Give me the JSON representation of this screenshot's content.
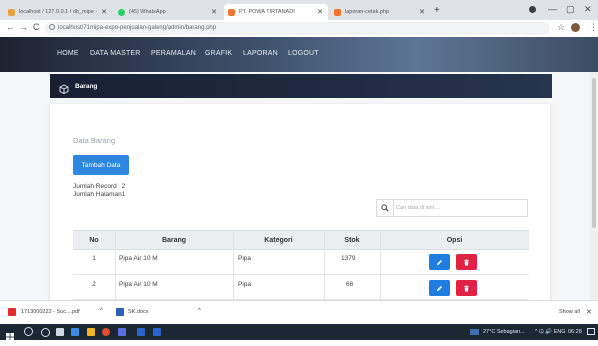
{
  "browser": {
    "tabs": [
      {
        "label": "localhost / 127.0.0.1 / db_mipe -",
        "color": "#e8a33d"
      },
      {
        "label": "(45) WhatsApp",
        "color": "#25d366"
      },
      {
        "label": "PT. POWA TIRTANADI",
        "color": "#f2762e"
      },
      {
        "label": "laporan-cetak.php",
        "color": "#f2762e"
      }
    ],
    "new_tab": "+",
    "url": "localhost/71mipa-expo-penjualan-galeng/admin/barang.php",
    "window_controls": [
      "—",
      "▢",
      "✕"
    ]
  },
  "nav": {
    "items": [
      "HOME",
      "DATA MASTER",
      "PERAMALAN",
      "GRAFIK",
      "LAPORAN",
      "LOGOUT"
    ]
  },
  "page": {
    "header_title": "Barang",
    "section_title": "Data Barang",
    "add_button": "Tambah Data",
    "record_label": "Jumlah Record",
    "record_value": "2",
    "page_label": "Jumlah Halaman",
    "page_value": "1",
    "search_placeholder": "Cari data di sini ..."
  },
  "table": {
    "headers": [
      "No",
      "Barang",
      "Kategori",
      "Stok",
      "Opsi"
    ],
    "rows": [
      {
        "no": "1",
        "barang": "Pipa Air 10 M",
        "kategori": "Pipa",
        "stok": "1379"
      },
      {
        "no": "2",
        "barang": "Pipa Air 10 M",
        "kategori": "Pipa",
        "stok": "66"
      }
    ]
  },
  "downloads": {
    "items": [
      "1713000222 - Suc....pdf",
      "SK.docx"
    ],
    "show_all": "Show all",
    "close": "✕"
  },
  "taskbar": {
    "weather": "27°C Sebagian...",
    "tray": "^ ⊡ 🔊 ENG",
    "time": "06:28"
  }
}
